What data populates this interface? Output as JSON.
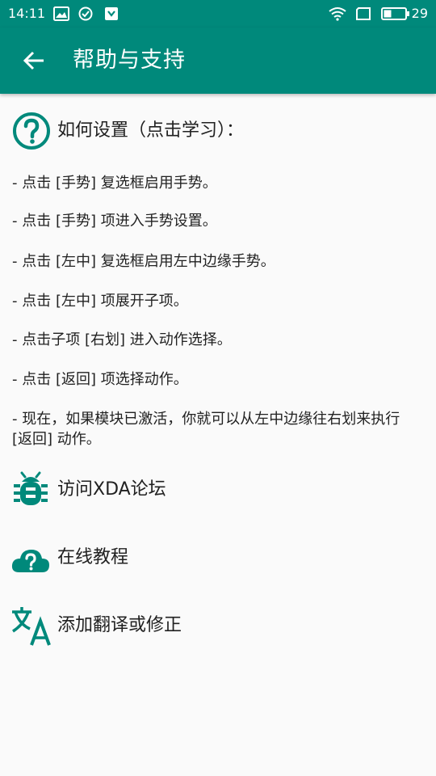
{
  "status_bar": {
    "time": "14:11",
    "battery": "29"
  },
  "toolbar": {
    "title": "帮助与支持"
  },
  "help": {
    "heading": "如何设置（点击学习）：",
    "steps": [
      "- 点击 [手势] 复选框启用手势。",
      "- 点击 [手势] 项进入手势设置。",
      "- 点击 [左中] 复选框启用左中边缘手势。",
      "- 点击 [左中] 项展开子项。",
      "- 点击子项 [右划] 进入动作选择。",
      "- 点击 [返回] 项选择动作。",
      "- 现在，如果模块已激活，你就可以从左中边缘往右划来执行 [返回] 动作。"
    ]
  },
  "links": [
    {
      "label": "访问XDA论坛",
      "icon": "bug-icon"
    },
    {
      "label": "在线教程",
      "icon": "cloud-help-icon"
    },
    {
      "label": "添加翻译或修正",
      "icon": "translate-icon"
    }
  ],
  "colors": {
    "primary": "#00897b",
    "text": "#212121",
    "background": "#fafafa"
  }
}
